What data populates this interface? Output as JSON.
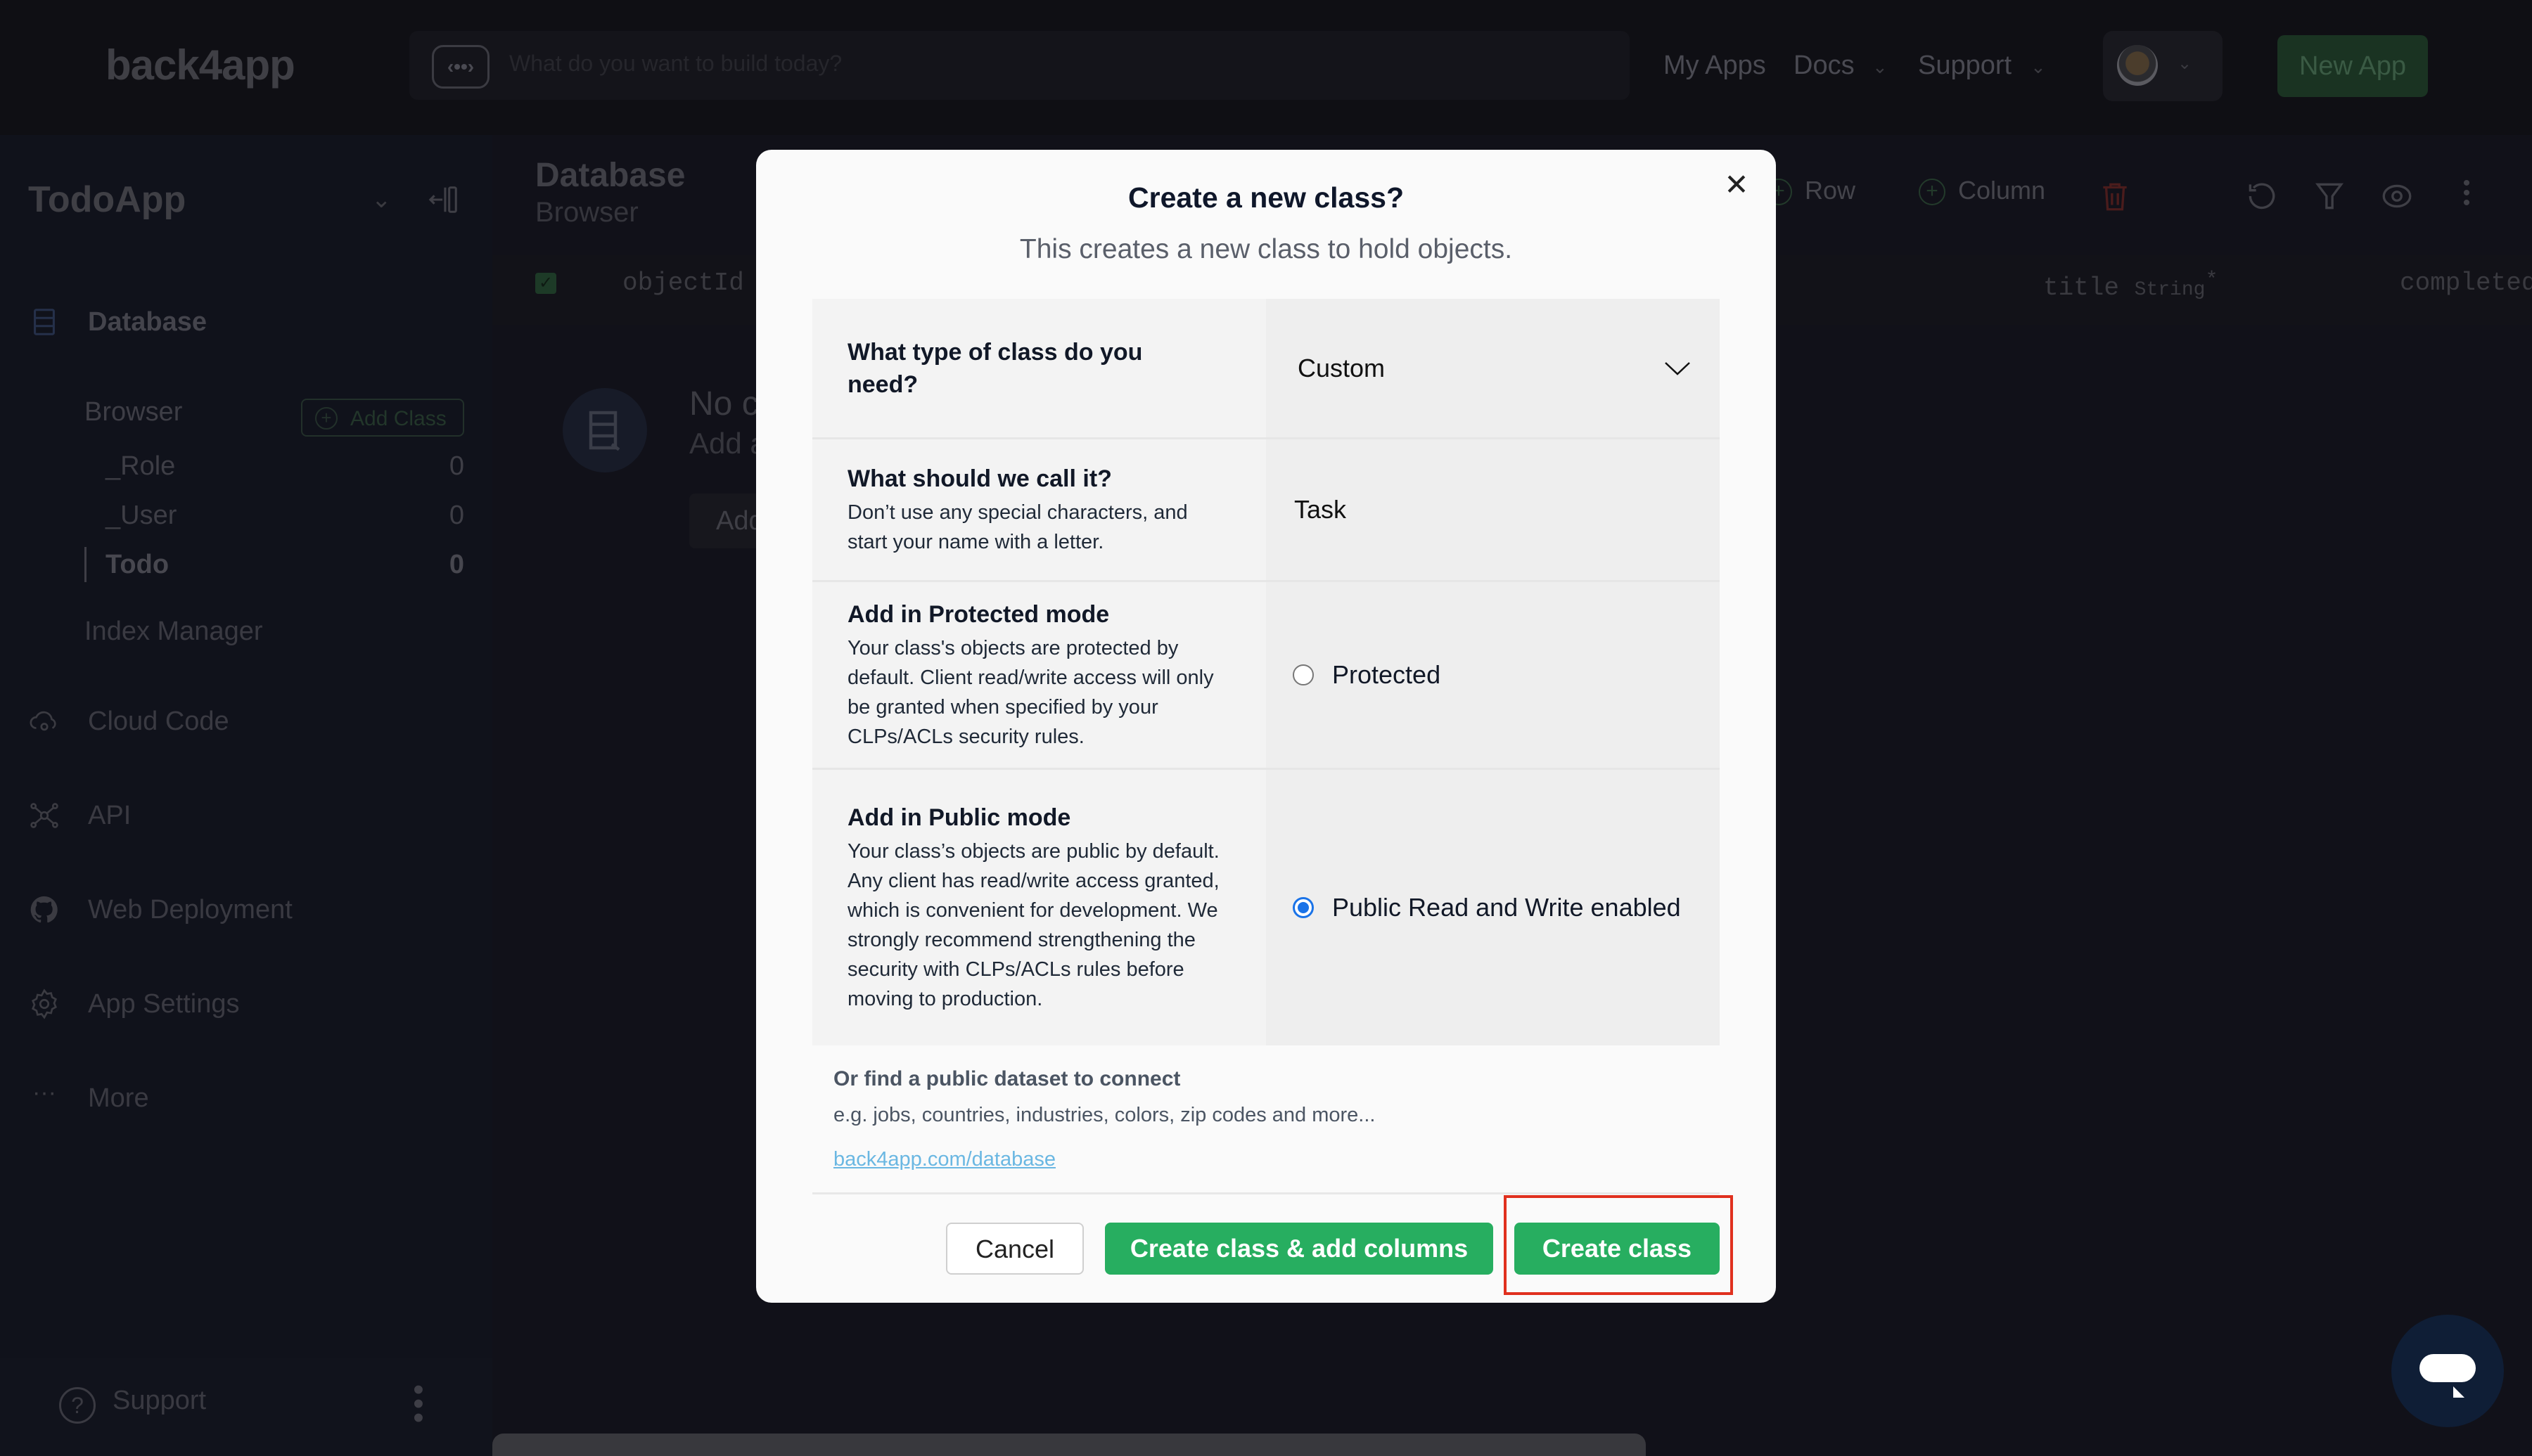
{
  "topbar": {
    "logo": "back4app",
    "prompt_placeholder": "What do you want to build today?",
    "nav": [
      {
        "label": "My Apps",
        "has_dropdown": false
      },
      {
        "label": "Docs",
        "has_dropdown": true
      },
      {
        "label": "Support",
        "has_dropdown": true
      }
    ],
    "new_app_label": "New App"
  },
  "sidebar": {
    "app_name": "TodoApp",
    "database_label": "Database",
    "browser_label": "Browser",
    "add_class_label": "Add Class",
    "classes": [
      {
        "name": "_Role",
        "count": "0",
        "active": false
      },
      {
        "name": "_User",
        "count": "0",
        "active": false
      },
      {
        "name": "Todo",
        "count": "0",
        "active": true
      }
    ],
    "index_manager_label": "Index Manager",
    "items": [
      {
        "label": "Cloud Code",
        "icon": "cloud-gear-icon"
      },
      {
        "label": "API",
        "icon": "api-network-icon"
      },
      {
        "label": "Web Deployment",
        "icon": "github-icon"
      },
      {
        "label": "App Settings",
        "icon": "gear-icon"
      },
      {
        "label": "More",
        "icon": "more-dots-icon"
      }
    ],
    "footer_support_label": "Support"
  },
  "main": {
    "title": "Database",
    "subtitle": "Browser",
    "toolbar": {
      "row_label": "Row",
      "column_label": "Column"
    },
    "columns": [
      {
        "name": "objectId",
        "type": ""
      },
      {
        "name": "title",
        "type": "String",
        "required_mark": "*"
      },
      {
        "name": "completed",
        "type": ""
      }
    ],
    "empty_title": "No c",
    "empty_sub": "Add a",
    "empty_btn": "Add"
  },
  "modal": {
    "title": "Create a new class?",
    "subtitle": "This creates a new class to hold objects.",
    "rows": {
      "type": {
        "question": "What type of class do you need?",
        "value": "Custom"
      },
      "name": {
        "question": "What should we call it?",
        "description": "Don’t use any special characters, and start your name with a letter.",
        "value": "Task"
      },
      "protected": {
        "question": "Add in Protected mode",
        "description": "Your class's objects are protected by default. Client read/write access will only be granted when specified by your CLPs/ACLs security rules.",
        "option_label": "Protected",
        "checked": false
      },
      "public": {
        "question": "Add in Public mode",
        "description": "Your class’s objects are public by default. Any client has read/write access granted, which is convenient for development. We strongly recommend strengthening the security with CLPs/ACLs rules before moving to production.",
        "option_label": "Public Read and Write enabled",
        "checked": true
      }
    },
    "dataset": {
      "heading": "Or find a public dataset to connect",
      "examples": "e.g. jobs, countries, industries, colors, zip codes and more...",
      "link": "back4app.com/database"
    },
    "buttons": {
      "cancel": "Cancel",
      "create_add_columns": "Create class & add columns",
      "create": "Create class"
    }
  },
  "colors": {
    "primary_green": "#27ae60",
    "radio_blue": "#1a73e8",
    "highlight_red": "#e0301e",
    "link_blue": "#6ab7e2"
  }
}
